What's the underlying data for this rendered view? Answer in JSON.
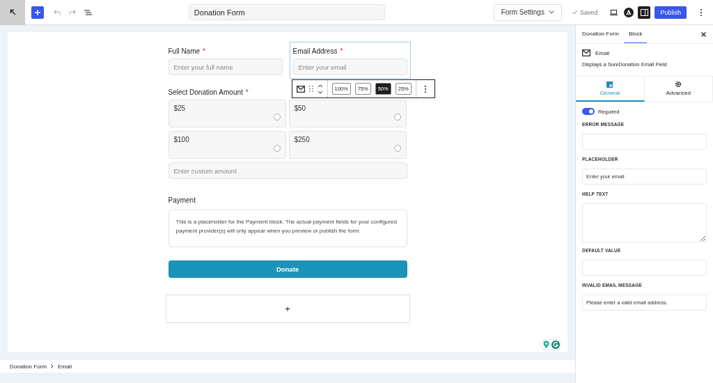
{
  "topbar": {
    "title": "Donation Form",
    "form_settings": "Form Settings",
    "saved": "Saved",
    "publish": "Publish",
    "sidebar_open": true
  },
  "form": {
    "fields": [
      {
        "label": "Full Name",
        "required": true,
        "placeholder": "Enter your full name",
        "selected": false
      },
      {
        "label": "Email Address",
        "required": true,
        "placeholder": "Enter your email",
        "selected": true
      }
    ],
    "required_mark": "*",
    "block_toolbar": {
      "widths": [
        {
          "label": "100%",
          "selected": false
        },
        {
          "label": "75%",
          "selected": false
        },
        {
          "label": "50%",
          "selected": true
        },
        {
          "label": "25%",
          "selected": false
        }
      ]
    },
    "donation": {
      "label": "Select Donation Amount",
      "required": true,
      "options": [
        {
          "amount": "$25",
          "selected": false
        },
        {
          "amount": "$50",
          "selected": false
        },
        {
          "amount": "$100",
          "selected": false
        },
        {
          "amount": "$250",
          "selected": false
        }
      ],
      "custom_placeholder": "Enter custom amount"
    },
    "payment": {
      "label": "Payment",
      "note": "This is a placeholder for the Payment block. The actual payment fields for your configured payment provider(s) will only appear when you preview or publish the form."
    },
    "submit": "Donate",
    "add_block": "+"
  },
  "sidebar": {
    "tabs": [
      {
        "label": "Donation Form",
        "selected": false
      },
      {
        "label": "Block",
        "selected": true
      }
    ],
    "block": {
      "name": "Email",
      "description": "Displays a SureDonation Email Field"
    },
    "subtabs": [
      {
        "label": "General",
        "selected": true
      },
      {
        "label": "Advanced",
        "selected": false
      }
    ],
    "required_toggle": {
      "label": "Required",
      "on": true
    },
    "settings": [
      {
        "kind": "input",
        "label": "ERROR MESSAGE"
      },
      {
        "kind": "input",
        "label": "PLACEHOLDER",
        "value": "Enter your email"
      },
      {
        "kind": "textarea",
        "label": "HELP TEXT"
      },
      {
        "kind": "input",
        "label": "DEFAULT VALUE"
      },
      {
        "kind": "input",
        "label": "INVALID EMAIL MESSAGE",
        "value": "Please enter a valid email address."
      }
    ]
  },
  "breadcrumb": [
    "Donation Form",
    "Email"
  ]
}
